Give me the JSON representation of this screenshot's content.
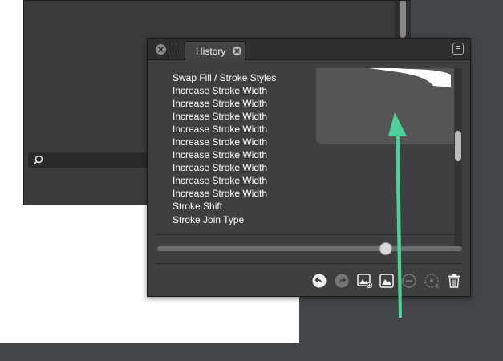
{
  "panel": {
    "tab_label": "History",
    "items": [
      "Swap Fill / Stroke Styles",
      "Increase Stroke Width",
      "Increase Stroke Width",
      "Increase Stroke Width",
      "Increase Stroke Width",
      "Increase Stroke Width",
      "Increase Stroke Width",
      "Increase Stroke Width",
      "Increase Stroke Width",
      "Increase Stroke Width",
      "Stroke Shift",
      "Stroke Join Type"
    ],
    "slider_position": 0.75
  },
  "icons": {
    "panel_close": "close-icon",
    "tab_close": "close-icon",
    "menu": "menu-icon",
    "search": "search-icon",
    "undo": "undo-icon",
    "redo": "redo-icon",
    "snapshot_add": "add-snapshot-icon",
    "snapshot": "snapshot-icon",
    "remove": "remove-icon",
    "merge": "merge-icon",
    "delete": "trash-icon"
  },
  "colors": {
    "annotation_arrow": "#4fcf9a",
    "panel_bg": "#3f3f3f"
  }
}
